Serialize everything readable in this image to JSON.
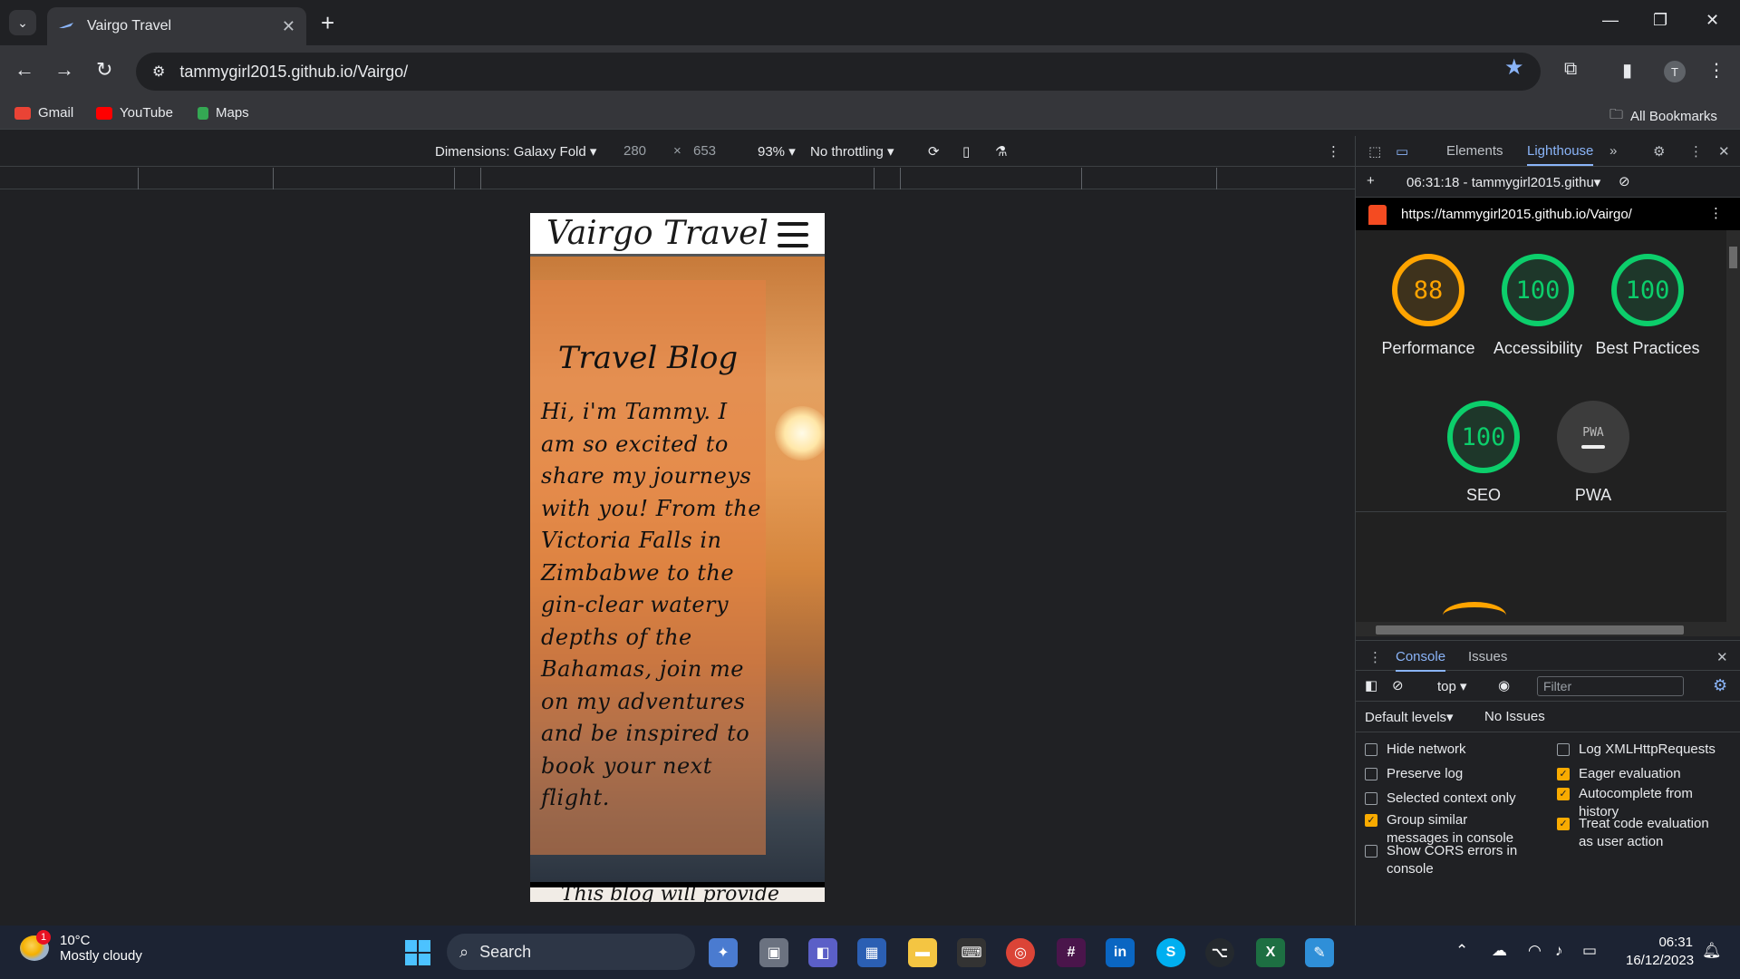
{
  "browser": {
    "tab_title": "Vairgo Travel",
    "url": "tammygirl2015.github.io/Vairgo/",
    "avatar_initial": "T",
    "bookmarks": [
      "Gmail",
      "YouTube",
      "Maps"
    ],
    "all_bookmarks": "All Bookmarks"
  },
  "device_toolbar": {
    "dimensions_label": "Dimensions: Galaxy Fold",
    "width": "280",
    "times": "×",
    "height": "653",
    "zoom": "93%",
    "throttling": "No throttling"
  },
  "site": {
    "brand": "Vairgo Travel",
    "blog_title": "Travel Blog",
    "blog_text": "Hi, i'm Tammy. I am so excited to share my journeys with you! From the Victoria Falls in Zimbabwe to the gin-clear watery depths of the Bahamas, join me on my adventures and be inspired to book your next flight.",
    "next_text": "This blog will provide"
  },
  "devtools": {
    "tabs": [
      "Elements",
      "Lighthouse"
    ],
    "report_selector": "06:31:18 - tammygirl2015.githu",
    "report_url": "https://tammygirl2015.github.io/Vairgo/",
    "scores": [
      {
        "value": "88",
        "label": "Performance",
        "color": "#ffa400"
      },
      {
        "value": "100",
        "label": "Accessibility",
        "color": "#0cce6b"
      },
      {
        "value": "100",
        "label": "Best Practices",
        "color": "#0cce6b"
      },
      {
        "value": "100",
        "label": "SEO",
        "color": "#0cce6b"
      }
    ],
    "pwa_label": "PWA",
    "pwa_badge": "PWA",
    "drawer_tabs": [
      "Console",
      "Issues"
    ],
    "context": "top",
    "filter_placeholder": "Filter",
    "default_levels": "Default levels",
    "no_issues": "No Issues",
    "options_left": [
      {
        "label": "Hide network",
        "checked": false
      },
      {
        "label": "Preserve log",
        "checked": false
      },
      {
        "label": "Selected context only",
        "checked": false
      },
      {
        "label": "Group similar messages in console",
        "checked": true
      },
      {
        "label": "Show CORS errors in console",
        "checked": false
      }
    ],
    "options_right": [
      {
        "label": "Log XMLHttpRequests",
        "checked": false
      },
      {
        "label": "Eager evaluation",
        "checked": true
      },
      {
        "label": "Autocomplete from history",
        "checked": true
      },
      {
        "label": "Treat code evaluation as user action",
        "checked": true
      }
    ]
  },
  "taskbar": {
    "temperature": "10°C",
    "weather": "Mostly cloudy",
    "weather_badge": "1",
    "search": "Search",
    "time": "06:31",
    "date": "16/12/2023"
  }
}
